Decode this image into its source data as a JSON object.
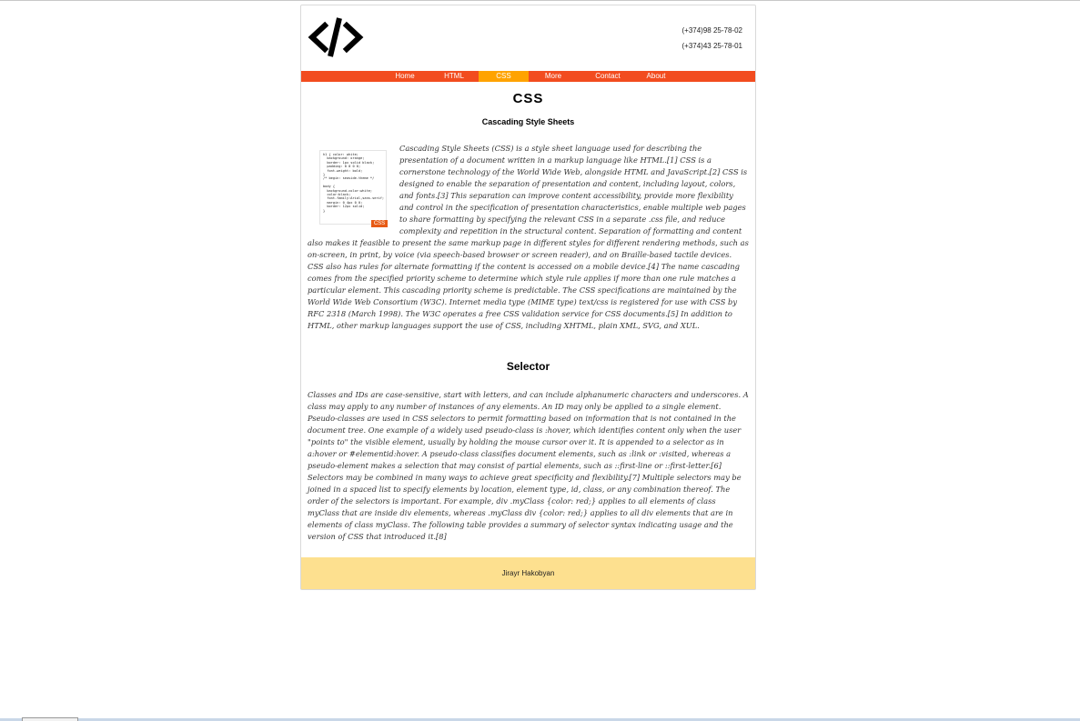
{
  "header": {
    "logo_icon": "code-brackets-icon",
    "phones": [
      "(+374)98 25-78-02",
      "(+374)43 25-78-01"
    ]
  },
  "nav": {
    "items": [
      {
        "label": "Home"
      },
      {
        "label": "HTML"
      },
      {
        "label": "CSS",
        "active": true
      },
      {
        "label": "More"
      },
      {
        "label": "Contact"
      },
      {
        "label": "About"
      }
    ],
    "bar_color": "#f24c1f",
    "active_color": "#ffa300"
  },
  "main": {
    "title": "CSS",
    "subtitle": "Cascading Style Sheets",
    "image_tag": "CSS",
    "image_code": "h1 { color: white;\n  background: orange;\n  border: 1px solid black;\n  padding: 0 0 0 0;\n  font-weight: bold;\n}\n/* begin: seaside-theme */\n\nbody {\n  background-color:white;\n  color:black;\n  font-family:Arial,sans-serif;\n  margin: 0 4px 0 0;\n  border: 12px solid;\n}",
    "intro": "Cascading Style Sheets (CSS) is a style sheet language used for describing the presentation of a document written in a markup language like HTML.[1] CSS is a cornerstone technology of the World Wide Web, alongside HTML and JavaScript.[2] CSS is designed to enable the separation of presentation and content, including layout, colors, and fonts.[3] This separation can improve content accessibility, provide more flexibility and control in the specification of presentation characteristics, enable multiple web pages to share formatting by specifying the relevant CSS in a separate .css file, and reduce complexity and repetition in the structural content. Separation of formatting and content also makes it feasible to present the same markup page in different styles for different rendering methods, such as on-screen, in print, by voice (via speech-based browser or screen reader), and on Braille-based tactile devices. CSS also has rules for alternate formatting if the content is accessed on a mobile device.[4] The name cascading comes from the specified priority scheme to determine which style rule applies if more than one rule matches a particular element. This cascading priority scheme is predictable. The CSS specifications are maintained by the World Wide Web Consortium (W3C). Internet media type (MIME type) text/css is registered for use with CSS by RFC 2318 (March 1998). The W3C operates a free CSS validation service for CSS documents.[5] In addition to HTML, other markup languages support the use of CSS, including XHTML, plain XML, SVG, and XUL.",
    "section_title": "Selector",
    "section_text": "Classes and IDs are case-sensitive, start with letters, and can include alphanumeric characters and underscores. A class may apply to any number of instances of any elements. An ID may only be applied to a single element. Pseudo-classes are used in CSS selectors to permit formatting based on information that is not contained in the document tree. One example of a widely used pseudo-class is :hover, which identifies content only when the user \"points to\" the visible element, usually by holding the mouse cursor over it. It is appended to a selector as in a:hover or #elementid:hover. A pseudo-class classifies document elements, such as :link or :visited, whereas a pseudo-element makes a selection that may consist of partial elements, such as ::first-line or ::first-letter.[6] Selectors may be combined in many ways to achieve great specificity and flexibility.[7] Multiple selectors may be joined in a spaced list to specify elements by location, element type, id, class, or any combination thereof. The order of the selectors is important. For example, div .myClass {color: red;} applies to all elements of class myClass that are inside div elements, whereas .myClass div {color: red;} applies to all div elements that are in elements of class myClass. The following table provides a summary of selector syntax indicating usage and the version of CSS that introduced it.[8]"
  },
  "footer": {
    "text": "Jirayr Hakobyan",
    "background": "#fde08f"
  }
}
